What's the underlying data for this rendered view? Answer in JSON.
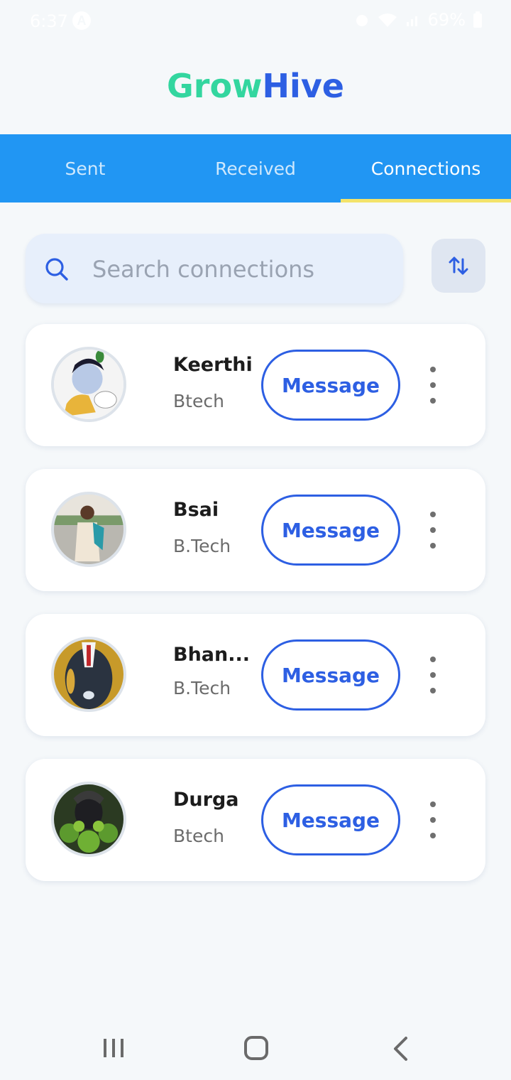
{
  "status_bar": {
    "time": "6:37",
    "battery": "69%"
  },
  "app": {
    "title_part1": "Grow",
    "title_part2": "Hive"
  },
  "tabs": [
    {
      "label": "Sent",
      "active": false
    },
    {
      "label": "Received",
      "active": false
    },
    {
      "label": "Connections",
      "active": true
    }
  ],
  "search": {
    "placeholder": "Search connections",
    "icon": "search-icon"
  },
  "sort_button": {
    "icon": "sort-arrows-icon"
  },
  "connections": [
    {
      "name": "Keerthi",
      "degree": "Btech",
      "button_label": "Message"
    },
    {
      "name": "Bsai",
      "degree": "B.Tech",
      "button_label": "Message"
    },
    {
      "name": "Bhan...",
      "degree": "B.Tech",
      "button_label": "Message"
    },
    {
      "name": "Durga",
      "degree": "Btech",
      "button_label": "Message"
    }
  ],
  "colors": {
    "brand_green": "#33d69f",
    "brand_blue": "#2d5fe3",
    "tab_bar": "#2196f3",
    "tab_indicator": "#f3e36a"
  }
}
